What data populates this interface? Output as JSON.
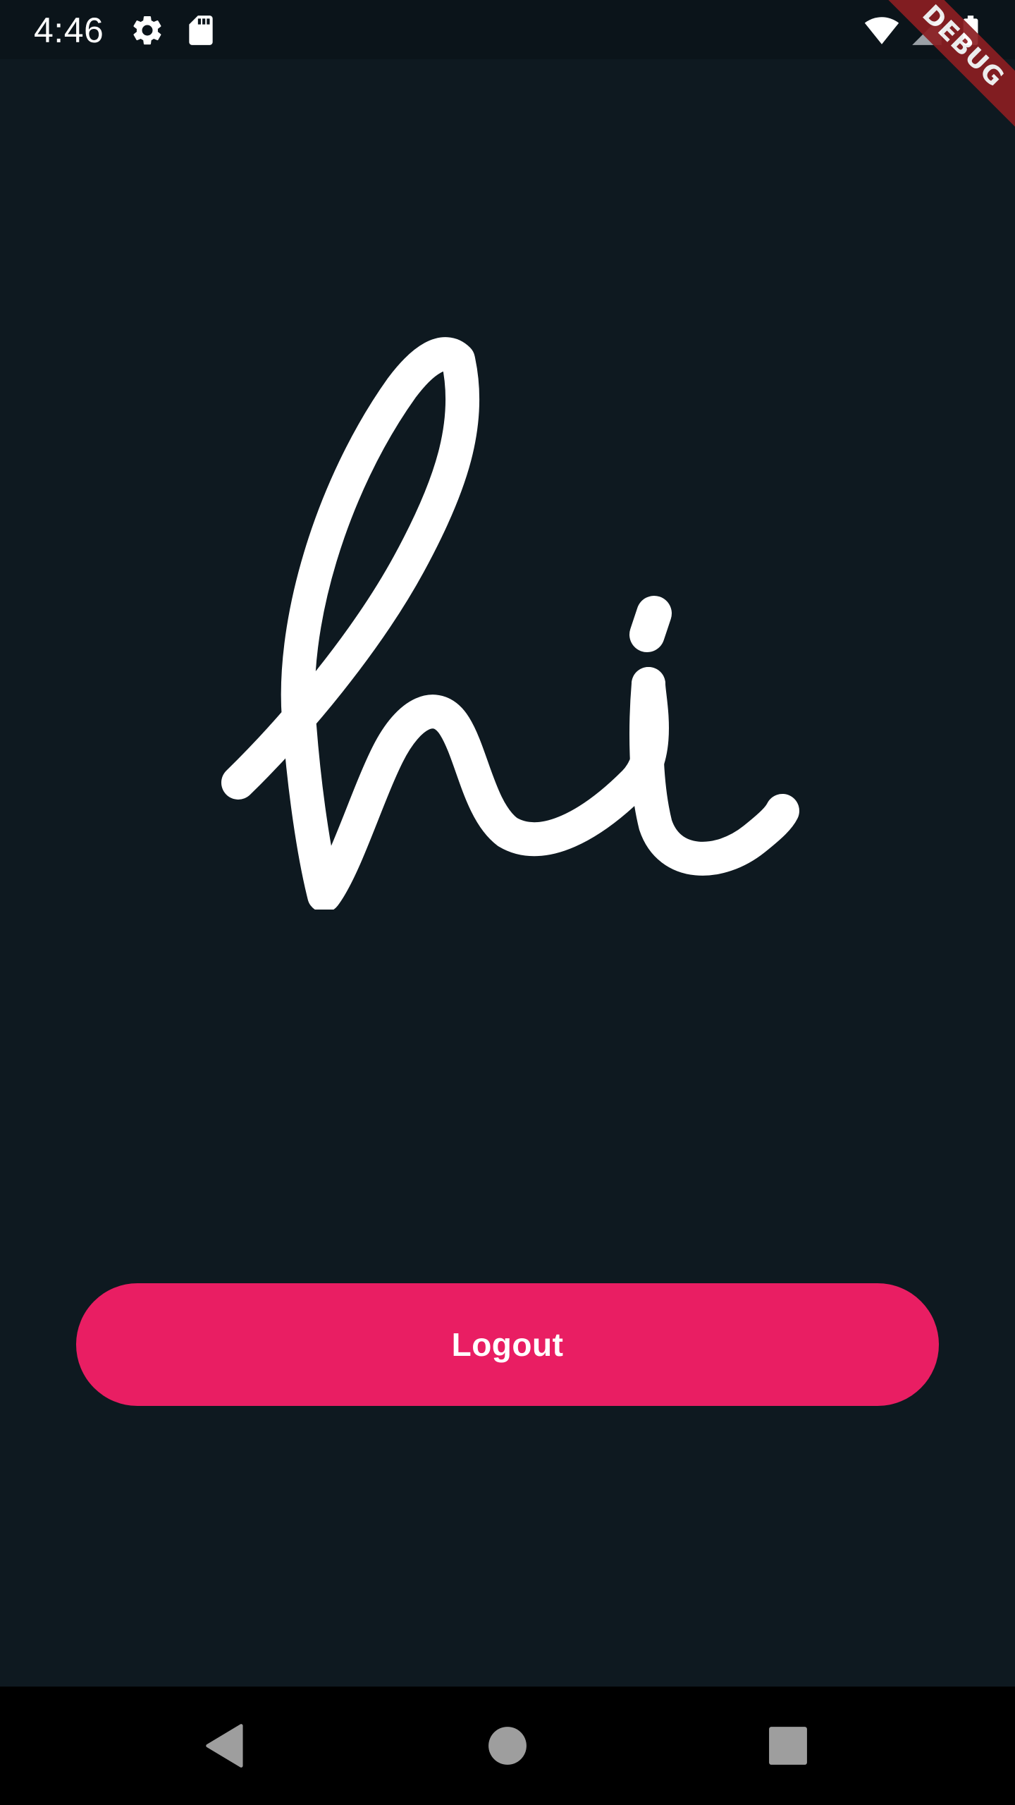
{
  "status_bar": {
    "time": "4:46",
    "icons": [
      "settings-icon",
      "sd-card-icon",
      "wifi-off-icon",
      "signal-icon",
      "battery-icon"
    ]
  },
  "debug_banner": {
    "label": "DEBUG"
  },
  "logo": {
    "text": "hi",
    "color": "#ffffff"
  },
  "logout": {
    "label": "Logout",
    "color": "#e91e63"
  },
  "nav_bar": {
    "buttons": [
      "back-icon",
      "home-icon",
      "recents-icon"
    ]
  },
  "colors": {
    "background": "#0e1920",
    "status_bar": "#0b141a",
    "accent": "#e91e63",
    "debug": "#8b1e22"
  }
}
